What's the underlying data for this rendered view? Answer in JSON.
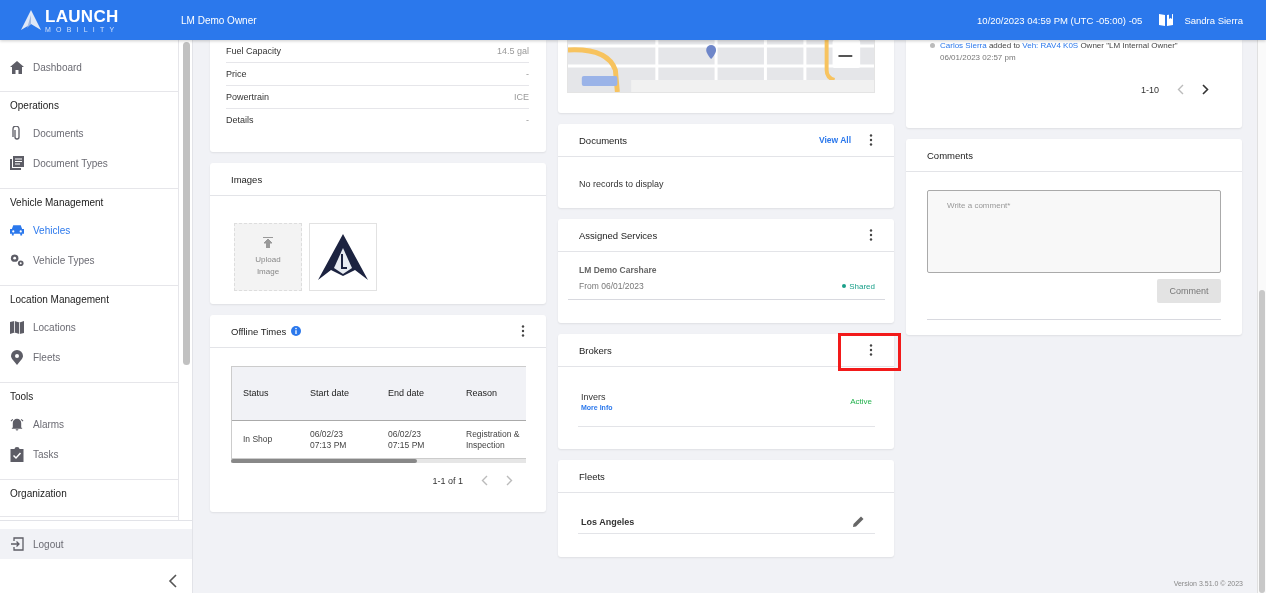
{
  "header": {
    "brand": "LAUNCH",
    "brand_sub": "MOBILITY",
    "account": "LM Demo Owner",
    "datetime": "10/20/2023 04:59 PM (UTC -05:00) -05",
    "user": "Sandra Sierra"
  },
  "sidebar": {
    "top_items": [
      {
        "label": "Dashboard",
        "selected": false
      }
    ],
    "sections": [
      {
        "title": "Operations",
        "items": [
          {
            "label": "Documents",
            "selected": false
          },
          {
            "label": "Document Types",
            "selected": false
          }
        ]
      },
      {
        "title": "Vehicle Management",
        "items": [
          {
            "label": "Vehicles",
            "selected": true
          },
          {
            "label": "Vehicle Types",
            "selected": false
          }
        ]
      },
      {
        "title": "Location Management",
        "items": [
          {
            "label": "Locations",
            "selected": false
          },
          {
            "label": "Fleets",
            "selected": false
          }
        ]
      },
      {
        "title": "Tools",
        "items": [
          {
            "label": "Alarms",
            "selected": false
          },
          {
            "label": "Tasks",
            "selected": false
          }
        ]
      },
      {
        "title": "Organization"
      }
    ],
    "logout": "Logout"
  },
  "specs": {
    "rows": [
      {
        "label": "Fuel Capacity",
        "value": "14.5 gal"
      },
      {
        "label": "Price",
        "value": "-"
      },
      {
        "label": "Powertrain",
        "value": "ICE"
      },
      {
        "label": "Details",
        "value": "-"
      }
    ]
  },
  "images": {
    "title": "Images",
    "upload_label": "Upload Image"
  },
  "offline_times": {
    "title": "Offline Times",
    "columns": [
      "Status",
      "Start date",
      "End date",
      "Reason"
    ],
    "rows": [
      [
        "In Shop",
        "06/02/23 07:13 PM",
        "06/02/23 07:15 PM",
        "Registration & Inspection"
      ]
    ],
    "pagination": {
      "range": "1-1 of 1",
      "prev_disabled": true,
      "next_disabled": true
    }
  },
  "documents": {
    "title": "Documents",
    "view_all": "View All",
    "empty": "No records to display"
  },
  "assigned_services": {
    "title": "Assigned Services",
    "items": [
      {
        "name": "LM Demo Carshare",
        "from": "From 06/01/2023",
        "status": "Shared"
      }
    ]
  },
  "brokers": {
    "title": "Brokers",
    "menu_highlighted": true,
    "items": [
      {
        "name": "Invers",
        "link": "More Info",
        "status": "Active"
      }
    ]
  },
  "fleets": {
    "title": "Fleets",
    "items": [
      {
        "name": "Los Angeles"
      }
    ]
  },
  "activity": {
    "entries": [
      {
        "actor": "Carlos Sierra",
        "action": "added to",
        "target": "Veh: RAV4 K0S",
        "detail": "Owner \"LM Internal Owner\"",
        "time": "06/01/2023 02:57 pm"
      }
    ],
    "pagination": {
      "range": "1-10",
      "prev_disabled": true,
      "next_disabled": false
    }
  },
  "comments": {
    "title": "Comments",
    "placeholder": "Write a comment*",
    "button": "Comment",
    "button_disabled": true
  },
  "version": "Version 3.51.0 © 2023"
}
